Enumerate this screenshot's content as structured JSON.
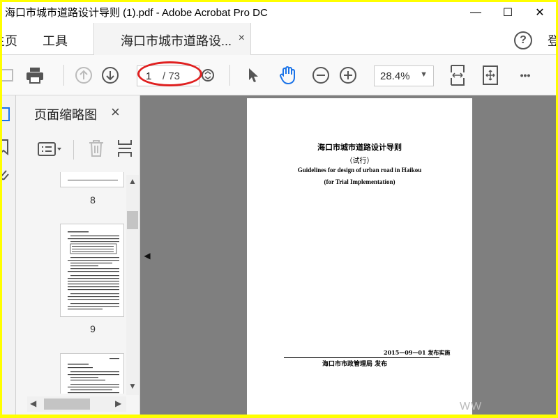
{
  "window": {
    "title": "海口市城市道路设计导则 (1).pdf - Adobe Acrobat Pro DC",
    "minimize_glyph": "—",
    "maximize_glyph": "☐",
    "close_glyph": "✕"
  },
  "tabs": {
    "home_label": "主页",
    "tools_label": "工具",
    "document_tab_label": "海口市城市道路设...",
    "close_glyph": "×",
    "help_glyph": "?",
    "signin_cut_label": "登"
  },
  "toolbar": {
    "current_page": "1",
    "total_pages": "/ 73",
    "zoom_value": "28.4%",
    "zoom_arrow": "▼",
    "more_glyph": "•••"
  },
  "thumbnail_panel": {
    "title": "页面缩略图",
    "close_glyph": "×",
    "pages": [
      {
        "label": "8"
      },
      {
        "label": "9"
      },
      {
        "label": ""
      }
    ]
  },
  "document": {
    "title_cn": "海口市城市道路设计导则",
    "subtitle_cn": "（试行）",
    "title_en": "Guidelines for design of urban road in Haikou",
    "subtitle_en": "(for Trial Implementation)",
    "date_line": "2015—09—01   发布实施",
    "issuer": "海口市市政管理局   发布"
  },
  "watermark": "WW",
  "colors": {
    "highlight_border": "#ffff00",
    "annotation_ellipse": "#e02020",
    "doc_background": "#7f7f7f",
    "hand_tool_accent": "#1a73e8"
  }
}
